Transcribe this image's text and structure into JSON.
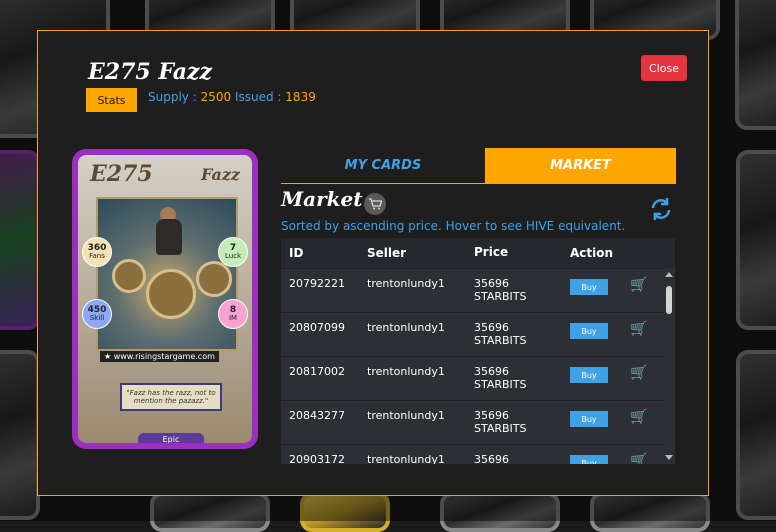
{
  "modal": {
    "title": "E275 Fazz",
    "stats_label": "Stats",
    "supply_label": "Supply :",
    "supply_value": "2500",
    "issued_label": "Issued :",
    "issued_value": "1839",
    "close_label": "Close"
  },
  "card": {
    "code": "E275",
    "name": "Fazz",
    "stats": {
      "fans": {
        "value": "360",
        "label": "Fans"
      },
      "luck": {
        "value": "7",
        "label": "Luck"
      },
      "skill": {
        "value": "450",
        "label": "Skill"
      },
      "im": {
        "value": "8",
        "label": "IM"
      }
    },
    "url": "www.risingstargame.com",
    "quote": "\"Fazz has the razz, not to mention the pazazz.\"",
    "rarity": "Epic"
  },
  "tabs": [
    {
      "label": "MY CARDS",
      "active": false
    },
    {
      "label": "MARKET",
      "active": true
    }
  ],
  "market": {
    "title": "Market",
    "sorted_text": "Sorted by ascending price. Hover to see HIVE equivalent.",
    "columns": [
      "ID",
      "Seller",
      "Price",
      "Action"
    ],
    "buy_label": "Buy",
    "rows": [
      {
        "id": "20792221",
        "seller": "trentonlundy1",
        "price_value": "35696",
        "price_unit": "STARBITS"
      },
      {
        "id": "20807099",
        "seller": "trentonlundy1",
        "price_value": "35696",
        "price_unit": "STARBITS"
      },
      {
        "id": "20817002",
        "seller": "trentonlundy1",
        "price_value": "35696",
        "price_unit": "STARBITS"
      },
      {
        "id": "20843277",
        "seller": "trentonlundy1",
        "price_value": "35696",
        "price_unit": "STARBITS"
      },
      {
        "id": "20903172",
        "seller": "trentonlundy1",
        "price_value": "35696",
        "price_unit": ""
      }
    ]
  },
  "icons": {
    "cart": "cart-icon",
    "refresh": "refresh-icon"
  },
  "colors": {
    "accent_orange": "#ffa500",
    "link_blue": "#3fa2e6",
    "close_red": "#e2333e",
    "cart_green": "#2ecc40"
  }
}
